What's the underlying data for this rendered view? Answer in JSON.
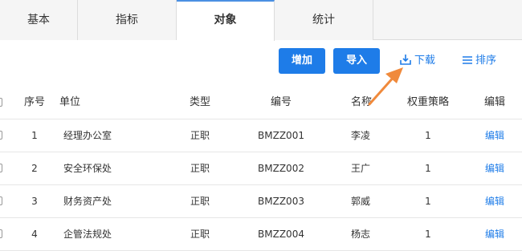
{
  "tabs": [
    {
      "label": "基本"
    },
    {
      "label": "指标"
    },
    {
      "label": "对象"
    },
    {
      "label": "统计"
    }
  ],
  "toolbar": {
    "add_label": "增加",
    "import_label": "导入",
    "download_label": "下载",
    "sort_label": "排序"
  },
  "table": {
    "headers": {
      "index": "序号",
      "unit": "单位",
      "type": "类型",
      "code": "编号",
      "name": "名称",
      "weight": "权重策略",
      "edit": "编辑"
    },
    "rows": [
      {
        "index": "1",
        "unit": "经理办公室",
        "type": "正职",
        "code": "BMZZ001",
        "name": "李凌",
        "weight": "1",
        "edit": "编辑"
      },
      {
        "index": "2",
        "unit": "安全环保处",
        "type": "正职",
        "code": "BMZZ002",
        "name": "王广",
        "weight": "1",
        "edit": "编辑"
      },
      {
        "index": "3",
        "unit": "财务资产处",
        "type": "正职",
        "code": "BMZZ003",
        "name": "郭威",
        "weight": "1",
        "edit": "编辑"
      },
      {
        "index": "4",
        "unit": "企管法规处",
        "type": "正职",
        "code": "BMZZ004",
        "name": "杨志",
        "weight": "1",
        "edit": "编辑"
      }
    ]
  },
  "colors": {
    "accent": "#1e7ce8",
    "annotation_arrow": "#f08a3c",
    "active_tab_border": "#4a90e2"
  }
}
